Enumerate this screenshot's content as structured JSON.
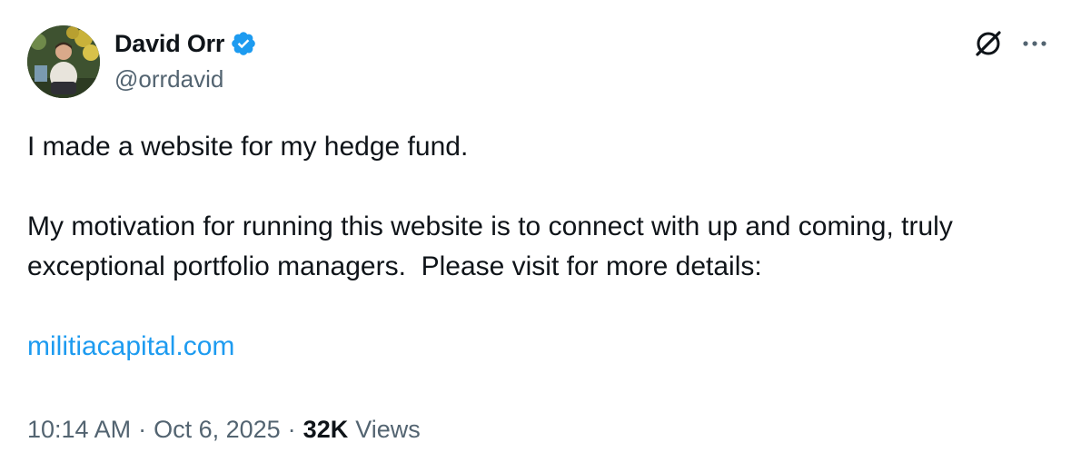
{
  "author": {
    "display_name": "David Orr",
    "handle": "@orrdavid",
    "verified": true,
    "verified_color": "#1d9bf0"
  },
  "header_actions": {
    "grok_icon": "grok-icon",
    "more_icon": "more-icon"
  },
  "tweet": {
    "line1": "I made a website for my hedge fund.",
    "line2": "My motivation for running this website is to connect with up and coming, truly exceptional portfolio managers.  Please visit for more details:",
    "link": "militiacapital.com",
    "link_color": "#1d9bf0"
  },
  "meta": {
    "time": "10:14 AM",
    "date": "Oct 6, 2025",
    "separator": "·",
    "views_count": "32K",
    "views_label": "Views"
  }
}
